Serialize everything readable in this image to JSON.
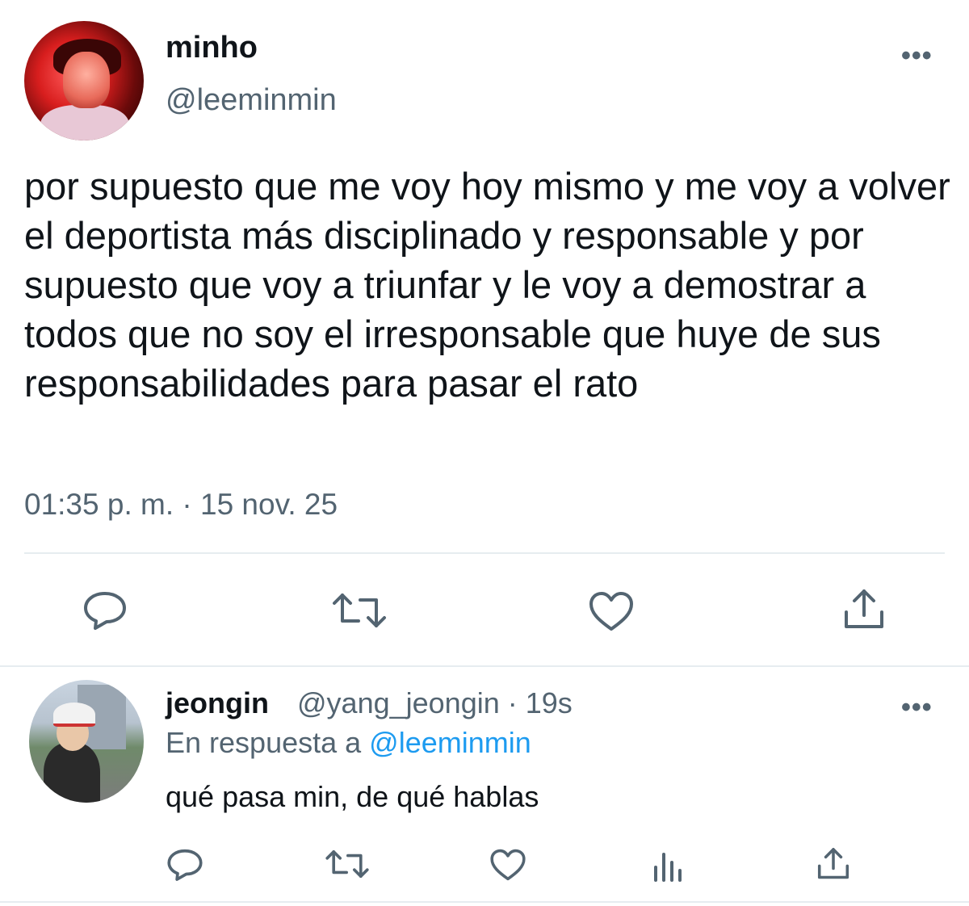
{
  "main_tweet": {
    "name": "minho",
    "handle": "@leeminmin",
    "more_icon": "more-horizontal-icon",
    "text": "por supuesto que me voy hoy mismo y me voy a volver el deportista más disciplinado y responsable y por supuesto que voy a triunfar y le voy a demostrar a todos que no soy el irresponsable que huye de sus responsabilidades para pasar el rato",
    "timestamp": "01:35 p. m. · 15 nov. 25",
    "actions": [
      "reply-icon",
      "retweet-icon",
      "like-icon",
      "share-icon"
    ]
  },
  "reply_tweet": {
    "name": "jeongin",
    "handle_time": "@yang_jeongin · 19s",
    "reply_prefix": "En respuesta a",
    "reply_mention": "@leeminmin",
    "text": "qué pasa min, de qué hablas",
    "actions": [
      "reply-icon",
      "retweet-icon",
      "like-icon",
      "views-icon",
      "share-icon"
    ]
  },
  "colors": {
    "text": "#0f1419",
    "secondary": "#536471",
    "link": "#1d9bf0",
    "divider": "#e6ecf0"
  }
}
